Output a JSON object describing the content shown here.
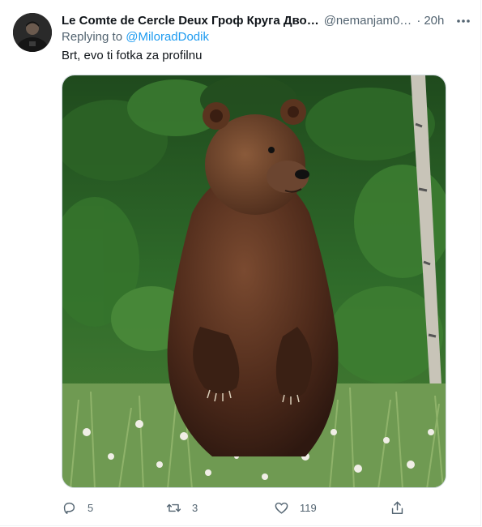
{
  "tweet": {
    "display_name": "Le Comte de Cercle Deux Гроф Круга Дво…",
    "handle": "@nemanjam0…",
    "separator": "·",
    "time": "20h",
    "replying_prefix": "Replying to ",
    "replying_to": "@MiloradDodik",
    "text": "Brt, evo ti fotka za profilnu",
    "media_icon": "bear-photo",
    "more_icon": "more-horizontal-icon"
  },
  "actions": {
    "reply_count": "5",
    "retweet_count": "3",
    "like_count": "119",
    "share_count": ""
  },
  "colors": {
    "link": "#1d9bf0",
    "secondary_text": "#536471",
    "primary_text": "#0f1419"
  }
}
